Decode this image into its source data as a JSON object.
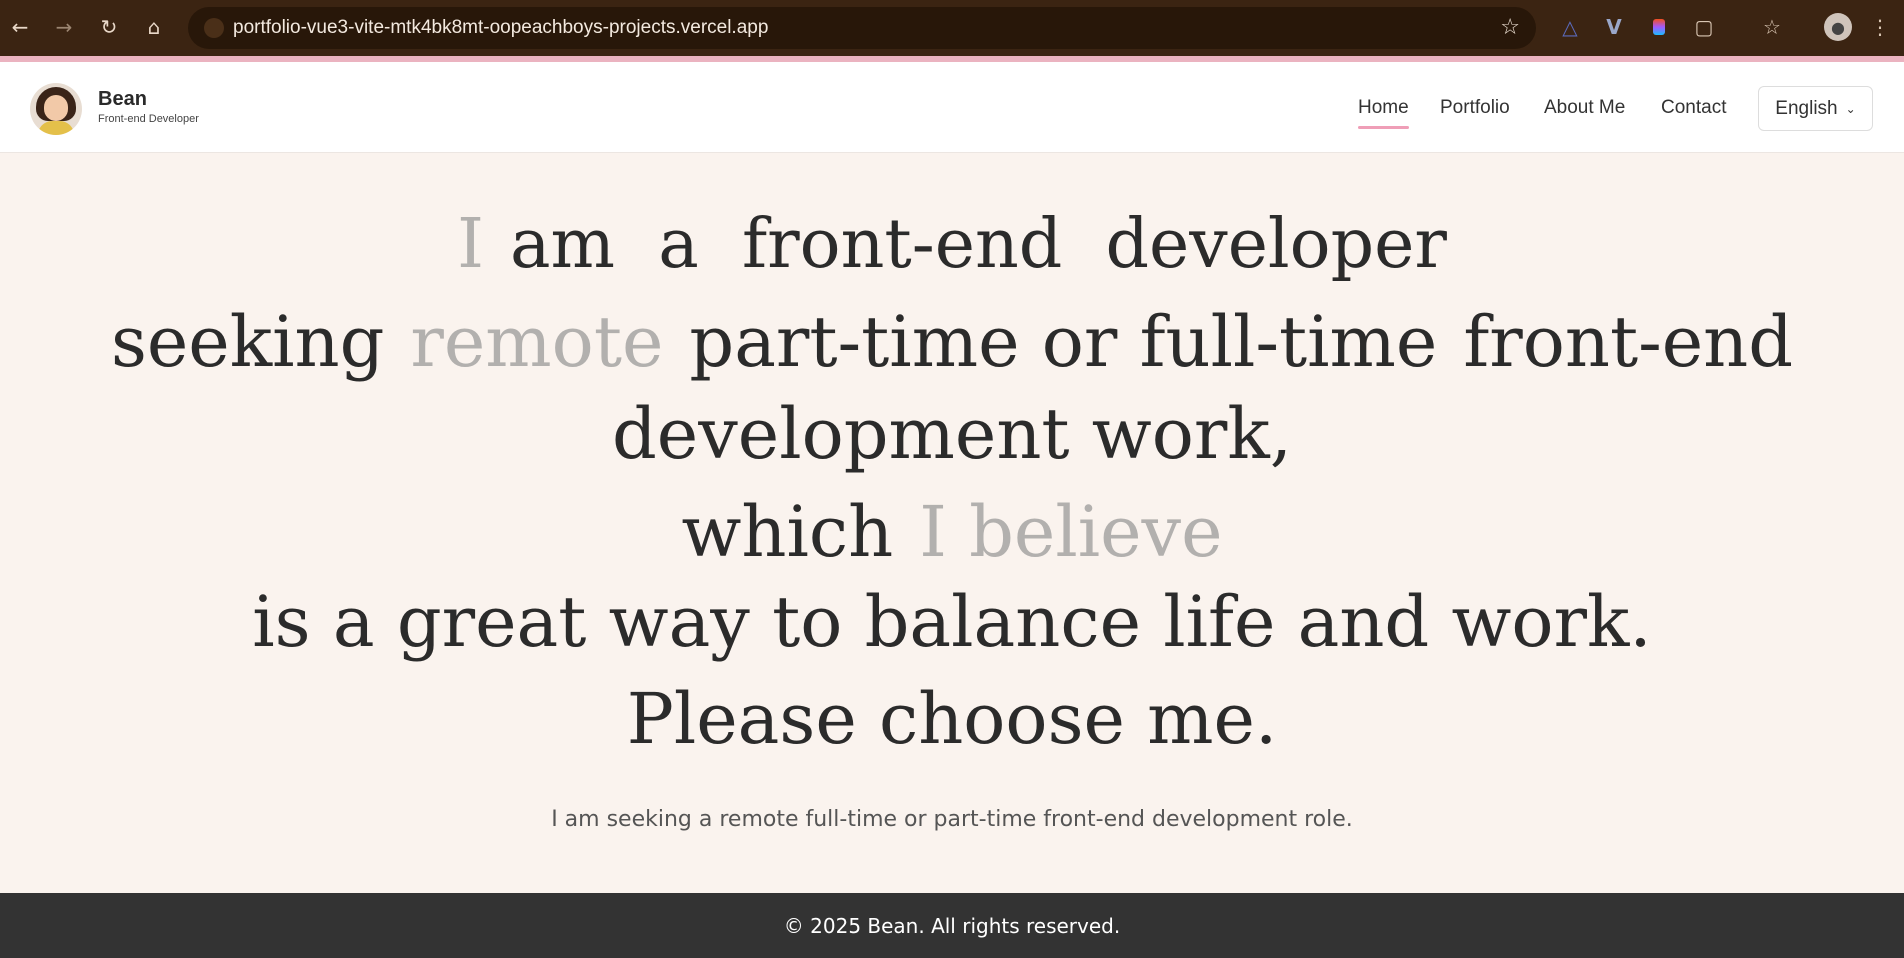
{
  "browser": {
    "url": "portfolio-vue3-vite-mtk4bk8mt-oopeachboys-projects.vercel.app",
    "icons": [
      "back-icon",
      "forward-icon",
      "reload-icon",
      "home-icon",
      "site-settings-icon",
      "bookmark-star-icon",
      "extension-icon",
      "vue-devtools-icon",
      "figma-icon",
      "extensions-puzzle-icon",
      "reading-list-icon",
      "profile-avatar-icon",
      "menu-icon"
    ]
  },
  "header": {
    "name": "Bean",
    "role": "Front-end Developer",
    "nav": [
      "Home",
      "Portfolio",
      "About Me",
      "Contact"
    ],
    "active_nav": "Home",
    "language": "English",
    "accent": "#ef9eb7"
  },
  "hero": {
    "line1": {
      "soft": "I",
      "rest": "am  a  front-end  developer"
    },
    "line2": {
      "a": "seeking",
      "soft": "remote",
      "b": "part-time or full-time",
      "c": "front-end"
    },
    "line3": "development work,",
    "line4": {
      "a": "which",
      "soft": "I believe"
    },
    "line5": "is a great way to balance life and work.",
    "line6": "Please choose me.",
    "tagline": "I am seeking a remote full-time or part-time front-end development role."
  },
  "footer": {
    "copyright": "© 2025 Bean. All rights reserved."
  }
}
